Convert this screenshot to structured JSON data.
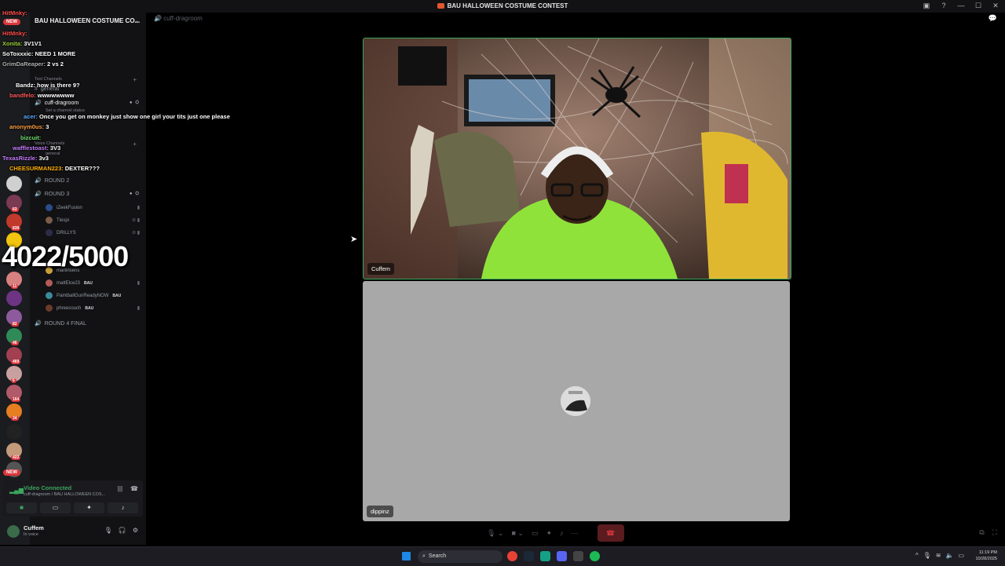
{
  "window": {
    "title": "BAU HALLOWEEN COSTUME CONTEST"
  },
  "server": {
    "name": "BAU HALLOWEEN COSTUME CO...",
    "new_label": "NEW"
  },
  "rail_badges": [
    "63",
    "839",
    "11",
    "82",
    "46",
    "469",
    "6",
    "164",
    "34",
    "422"
  ],
  "channels": {
    "text_category": "Text Channels",
    "general": "general",
    "active_voice": "cuff-dragroom",
    "channel_status": "Set a channel status",
    "voice_category": "Voice Channels",
    "general_voice": "general",
    "rounds": [
      "ROUND 2",
      "ROUND 3",
      "ROUND 4 FINAL"
    ]
  },
  "voice_users": [
    {
      "name": "iZeekFusion",
      "tag": ""
    },
    {
      "name": "Tlespi",
      "tag": ""
    },
    {
      "name": "DRILLYS",
      "tag": ""
    },
    {
      "name": "martinsens",
      "tag": ""
    },
    {
      "name": "mattElce23",
      "tag": "BAU"
    },
    {
      "name": "PaintballGunReadyNOW",
      "tag": "BAU"
    },
    {
      "name": "phreecouch",
      "tag": "BAU"
    }
  ],
  "voice_panel": {
    "status": "Video Connected",
    "location": "cuff-dragroom / BAU HALLOWEEN COS..."
  },
  "user": {
    "name": "Cuffem",
    "status": "In voice"
  },
  "chat": [
    {
      "user": "HitMnky:",
      "text": "",
      "color": "#ff4d4d"
    },
    {
      "user": "HitMnky:",
      "text": "",
      "color": "#ff4d4d"
    },
    {
      "user": "Xonita:",
      "text": "3V1V1",
      "color": "#9acd32"
    },
    {
      "user": "SoToxxxic:",
      "text": "NEED 1 MORE",
      "color": "#ffffff"
    },
    {
      "user": "GrimDaReaper:",
      "text": "2 vs 2",
      "color": "#b0b0b0"
    },
    {
      "user": "Bandz:",
      "text": "how is there 9?",
      "color": "#ffffff"
    },
    {
      "user": "bandfelo:",
      "text": "wwwwwwww",
      "color": "#ff5a5a"
    },
    {
      "user": "acer:",
      "text": "Once you get on monkey just show one girl your tits just one please",
      "color": "#5aa9ff"
    },
    {
      "user": "anonym0us:",
      "text": "3",
      "color": "#ff9f40"
    },
    {
      "user": "bizcuit:",
      "text": "",
      "color": "#6fe06f"
    },
    {
      "user": "wafflestoast:",
      "text": "3V3",
      "color": "#c77dff"
    },
    {
      "user": "TexasRizzle:",
      "text": "3v3",
      "color": "#c77dff"
    },
    {
      "user": "CHEESURMAN223:",
      "text": "DEXTER???",
      "color": "#ffb000"
    }
  ],
  "counter": "4022/5000",
  "main": {
    "channel_header": "cuff-dragroom"
  },
  "streams": [
    {
      "name": "Cuffem"
    },
    {
      "name": "dippinz"
    }
  ],
  "taskbar": {
    "search_placeholder": "Search",
    "time": "11:19 PM",
    "date": "10/28/2025"
  }
}
